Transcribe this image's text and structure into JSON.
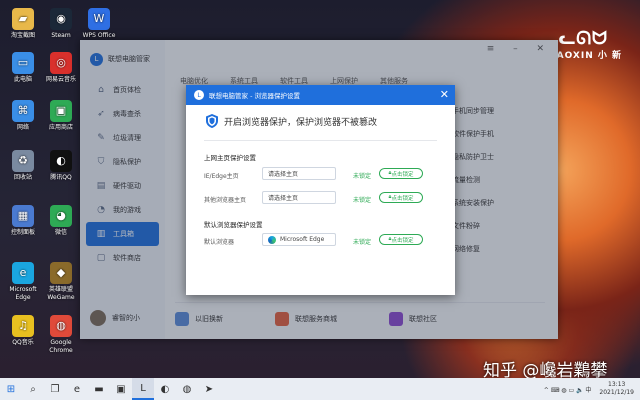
{
  "desktop": {
    "icons": [
      {
        "label": "淘宝截图",
        "icon": "folder-icon",
        "color": "#e8b84a",
        "glyph": "▰"
      },
      {
        "label": "Steam",
        "icon": "steam-icon",
        "color": "#1b2838",
        "glyph": "◉"
      },
      {
        "label": "WPS Office",
        "icon": "wps-icon",
        "color": "#2f6fe4",
        "glyph": "W"
      },
      {
        "label": "此电脑",
        "icon": "computer-icon",
        "color": "#3a8ee6",
        "glyph": "▭"
      },
      {
        "label": "网易云音乐",
        "icon": "music-icon",
        "color": "#d9302c",
        "glyph": "◎"
      },
      {
        "label": "网络",
        "icon": "network-icon",
        "color": "#3a8ee6",
        "glyph": "⌘"
      },
      {
        "label": "应用商店",
        "icon": "store-icon",
        "color": "#2eaa55",
        "glyph": "▣"
      },
      {
        "label": "回收站",
        "icon": "recycle-bin-icon",
        "color": "#7a8aa0",
        "glyph": "♻"
      },
      {
        "label": "腾讯QQ",
        "icon": "qq-icon",
        "color": "#111",
        "glyph": "◐"
      },
      {
        "label": "控制面板",
        "icon": "control-panel-icon",
        "color": "#4a7ad0",
        "glyph": "▦"
      },
      {
        "label": "微信",
        "icon": "wechat-icon",
        "color": "#2eaa55",
        "glyph": "◕"
      },
      {
        "label": "Microsoft Edge",
        "icon": "edge-icon",
        "color": "#1aa6e0",
        "glyph": "e"
      },
      {
        "label": "英雄联盟WeGame",
        "icon": "lol-icon",
        "color": "#8a6a2a",
        "glyph": "◆"
      },
      {
        "label": "QQ音乐",
        "icon": "qqmusic-icon",
        "color": "#e8c020",
        "glyph": "♫"
      },
      {
        "label": "Google Chrome",
        "icon": "chrome-icon",
        "color": "#e04a3a",
        "glyph": "◍"
      }
    ],
    "brand_mark": "ᓚᘏᗢ",
    "brand": "XIAOXIN 小 新",
    "watermark": "知乎 @巉岩鸈攀"
  },
  "app": {
    "title": "联想电脑管家",
    "logo": "L",
    "window_controls": "≡ – ✕",
    "sidebar": [
      {
        "label": "首页体检",
        "icon": "home-icon",
        "glyph": "⌂"
      },
      {
        "label": "病毒查杀",
        "icon": "rocket-icon",
        "glyph": "➶"
      },
      {
        "label": "垃圾清理",
        "icon": "broom-icon",
        "glyph": "✎"
      },
      {
        "label": "隐私保护",
        "icon": "shield-icon",
        "glyph": "⛉"
      },
      {
        "label": "硬件驱动",
        "icon": "chip-icon",
        "glyph": "▤"
      },
      {
        "label": "我的游戏",
        "icon": "game-icon",
        "glyph": "◔"
      },
      {
        "label": "工具箱",
        "icon": "toolbox-icon",
        "glyph": "▥",
        "active": true
      },
      {
        "label": "软件商店",
        "icon": "store-icon",
        "glyph": "▢"
      }
    ],
    "user_name": "睿智的小",
    "tabs": [
      "电脑优化",
      "系统工具",
      "软件工具",
      "上网保护",
      "其他服务"
    ],
    "right_list": [
      "手机同步管理",
      "软件保护手机",
      "隐私防护卫士",
      "流量检测",
      "系统安装保护",
      "文件粉碎",
      "网络修复"
    ],
    "bottom": [
      {
        "label": "以旧换新",
        "icon": "laptop-icon",
        "color": "#5a8ad8"
      },
      {
        "label": "联想服务商城",
        "icon": "shop-icon",
        "color": "#e06040"
      },
      {
        "label": "联想社区",
        "icon": "community-icon",
        "color": "#8a4ad0"
      }
    ]
  },
  "dialog": {
    "header": "联想电脑管家 - 浏览器保护设置",
    "title": "开启浏览器保护，保护浏览器不被篡改",
    "section1": "上网主页保护设置",
    "rows": [
      {
        "label": "IE/Edge主页",
        "value": "请选择主页",
        "status": "未锁定",
        "button": "点击锁定"
      },
      {
        "label": "其他浏览器主页",
        "value": "请选择主页",
        "status": "未锁定",
        "button": "点击锁定"
      }
    ],
    "section2": "默认浏览器保护设置",
    "default_row": {
      "label": "默认浏览器",
      "value": "Microsoft Edge",
      "status": "未锁定",
      "button": "点击锁定"
    }
  },
  "taskbar": {
    "start_icon": "⊞",
    "items": [
      {
        "icon": "search-icon",
        "glyph": "⌕"
      },
      {
        "icon": "taskview-icon",
        "glyph": "❐"
      },
      {
        "icon": "edge-taskbar-icon",
        "glyph": "e"
      },
      {
        "icon": "explorer-icon",
        "glyph": "▬"
      },
      {
        "icon": "store-taskbar-icon",
        "glyph": "▣"
      },
      {
        "icon": "lenovo-manager-icon",
        "glyph": "L",
        "active": true
      },
      {
        "icon": "qq-taskbar-icon",
        "glyph": "◐"
      },
      {
        "icon": "chrome-taskbar-icon",
        "glyph": "◍"
      },
      {
        "icon": "arrow-icon",
        "glyph": "➤"
      }
    ],
    "tray": "^ ⌨ ◍ ▭ 🔈 中",
    "time": "13:13",
    "date": "2021/12/19"
  }
}
